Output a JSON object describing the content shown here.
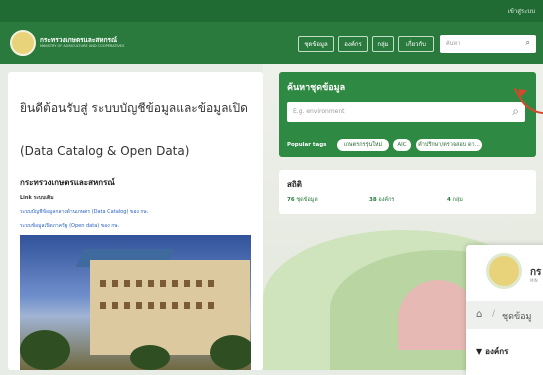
{
  "topbar": {
    "login": "เข้าสู่ระบบ"
  },
  "header": {
    "title": "กระทรวงเกษตรและสหกรณ์",
    "subtitle": "MINISTRY OF AGRICULTURE AND COOPERATIVES",
    "nav": [
      "ชุดข้อมูล",
      "องค์กร",
      "กลุ่ม",
      "เกี่ยวกับ"
    ],
    "search_placeholder": "ค้นหา"
  },
  "intro": {
    "welcome": "ยินดีต้อนรับสู่ ระบบบัญชีข้อมูลและข้อมูลเปิด",
    "catalog": "(Data Catalog & Open Data)",
    "ministry": "กระทรวงเกษตรและสหกรณ์",
    "link_label": "Link ระบบเดิม",
    "link1": "ระบบบัญชีข้อมูลกลางด้านเกษตร (Data Catalog) ของ กษ.",
    "link2": "ระบบข้อมูลเปิดภาครัฐ (Open data) ของ กษ."
  },
  "search_panel": {
    "title": "ค้นหาชุดข้อมูล",
    "placeholder": "E.g. environment",
    "popular_label": "Popular tags",
    "tags": [
      "เกษตรกรรุ่นใหม่",
      "AIC",
      "คำปรึกษา/ตรวจสอบ ดา..."
    ]
  },
  "stats": {
    "title": "สถิติ",
    "datasets_count": "76",
    "datasets_label": "ชุดข้อมูล",
    "orgs_count": "38",
    "orgs_label": "องค์กร",
    "groups_count": "4",
    "groups_label": "กลุ่ม"
  },
  "popup": {
    "title": "กร",
    "subtitle": "MIN",
    "breadcrumb": "ชุดข้อมู",
    "org_label": "องค์กร"
  },
  "colors": {
    "primary": "#2a7a3d",
    "accent": "#2e8a42",
    "arrow": "#d9472a"
  }
}
